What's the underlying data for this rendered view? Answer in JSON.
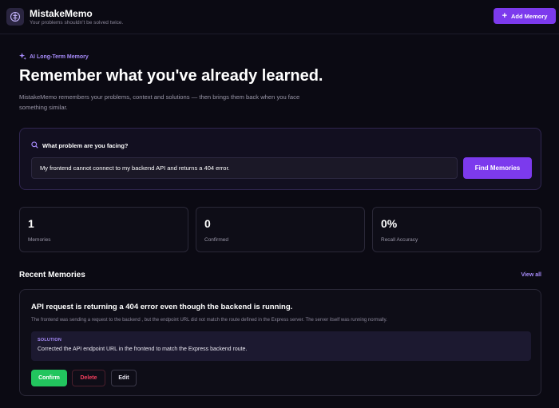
{
  "header": {
    "title": "MistakeMemo",
    "tagline": "Your problems shouldn't be solved twice.",
    "add_button": "Add Memory"
  },
  "hero": {
    "badge": "AI Long-Term Memory",
    "title": "Remember what you've already learned.",
    "subtitle": "MistakeMemo remembers your problems, context and solutions — then brings them back when you face something similar."
  },
  "search": {
    "label": "What problem are you facing?",
    "value": "My frontend cannot connect to my backend API and returns a 404 error.",
    "button": "Find Memories"
  },
  "stats": [
    {
      "value": "1",
      "label": "Memories"
    },
    {
      "value": "0",
      "label": "Confirmed"
    },
    {
      "value": "0%",
      "label": "Recall Accuracy"
    }
  ],
  "recent": {
    "title": "Recent Memories",
    "view_all": "View all",
    "items": [
      {
        "title": "API request is returning a 404 error even though the backend is running.",
        "description": "The frontend was sending a request to the backend , but the endpoint URL did not match the route defined in the Express server. The server itself was running normally.",
        "solution_label": "SOLUTION",
        "solution": "Corrected the API endpoint URL in the frontend to match the Express backend route.",
        "actions": {
          "confirm": "Confirm",
          "delete": "Delete",
          "edit": "Edit"
        }
      }
    ]
  },
  "colors": {
    "accent": "#7c3aed",
    "accent_light": "#a78bfa",
    "success": "#22c55e",
    "danger": "#f43f5e",
    "background": "#0b0a13"
  }
}
